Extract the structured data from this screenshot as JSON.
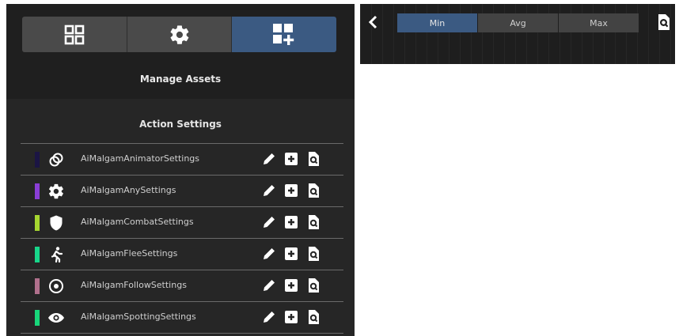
{
  "left_panel": {
    "top_tabs": [
      {
        "icon": "grid-icon",
        "active": false
      },
      {
        "icon": "gear-icon",
        "active": false
      },
      {
        "icon": "grid-add-icon",
        "active": true
      }
    ],
    "manage_title": "Manage Assets",
    "action_title": "Action Settings",
    "rows": [
      {
        "label": "AiMalgamAnimatorSettings",
        "color": "#1b1544",
        "icon": "animator-rings-icon"
      },
      {
        "label": "AiMalgamAnySettings",
        "color": "#8a3ed6",
        "icon": "gear-icon"
      },
      {
        "label": "AiMalgamCombatSettings",
        "color": "#a6d630",
        "icon": "shield-icon"
      },
      {
        "label": "AiMalgamFleeSettings",
        "color": "#18d68a",
        "icon": "running-person-icon"
      },
      {
        "label": "AiMalgamFollowSettings",
        "color": "#b0708c",
        "icon": "target-circle-icon"
      },
      {
        "label": "AiMalgamSpottingSettings",
        "color": "#18d67a",
        "icon": "eye-icon"
      }
    ]
  },
  "right_panel": {
    "segments": [
      {
        "label": "Min",
        "active": true
      },
      {
        "label": "Avg",
        "active": false
      },
      {
        "label": "Max",
        "active": false
      }
    ]
  },
  "colors": {
    "accent": "#3b5a82",
    "panel_bg": "#1f1f1f",
    "button_bg": "#4a4a4a"
  }
}
